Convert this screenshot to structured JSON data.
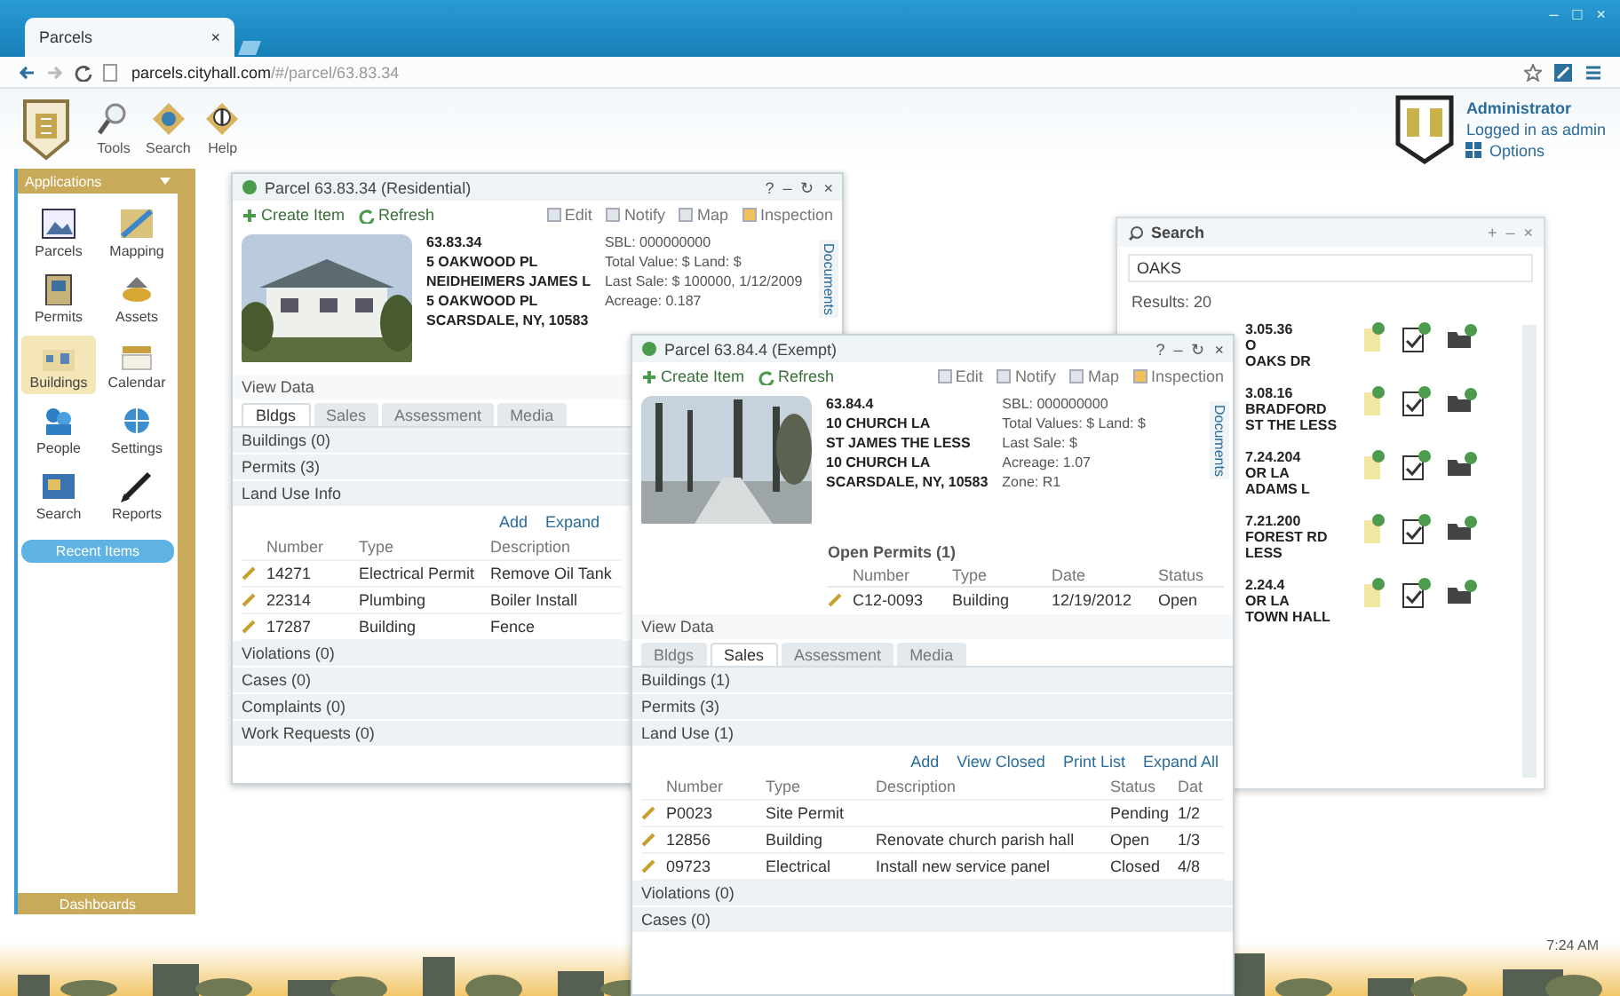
{
  "browser": {
    "tab_title": "Parcels",
    "tab_close": "×",
    "url": "parcels.cityhall.com",
    "url_tail": "/#/parcel/63.83.34",
    "window_controls": [
      "–",
      "□",
      "×"
    ]
  },
  "toolbar": {
    "items": [
      {
        "label": "Tools"
      },
      {
        "label": "Search"
      },
      {
        "label": "Help"
      }
    ]
  },
  "user": {
    "name": "Administrator",
    "status": "Logged in as admin",
    "menu": "Options"
  },
  "sidebar": {
    "title": "Applications",
    "items": [
      {
        "label": "Parcels",
        "selected": false
      },
      {
        "label": "Mapping",
        "selected": false
      },
      {
        "label": "Permits",
        "selected": false
      },
      {
        "label": "Assets",
        "selected": false
      },
      {
        "label": "Buildings",
        "selected": true
      },
      {
        "label": "Calendar",
        "selected": false
      },
      {
        "label": "People",
        "selected": false
      },
      {
        "label": "Settings",
        "selected": false
      },
      {
        "label": "Search",
        "selected": false
      },
      {
        "label": "Reports",
        "selected": false
      }
    ],
    "recent": "Recent Items",
    "footer": "Dashboards"
  },
  "windows": [
    {
      "title": "Parcel 63.83.34 (Residential)",
      "controls": [
        "?",
        "–",
        "↻",
        "×"
      ],
      "actions": [
        "Create Item",
        "Refresh"
      ],
      "right_actions": [
        "Edit",
        "Notify",
        "Map",
        "Inspection"
      ],
      "photo": {
        "kind": "picture"
      },
      "address": [
        "63.83.34",
        "5 OAKWOOD PL",
        "NEIDHEIMERS JAMES L",
        "5 OAKWOOD PL",
        "SCARSDALE, NY, 10583"
      ],
      "facts": [
        "SBL: 000000000",
        "Total Value: $ Land: $",
        "Last Sale: $ 100000, 1/12/2009",
        "Acreage: 0.187"
      ],
      "side_tab": "Documents",
      "section_title": "View Data",
      "tabs": [
        {
          "label": "Bldgs",
          "selected": true
        },
        {
          "label": "Sales",
          "selected": false
        },
        {
          "label": "Assessment",
          "selected": false
        },
        {
          "label": "Media",
          "selected": false
        }
      ],
      "sections": [
        "Buildings (0)",
        "Permits (3)",
        "Land Use Info"
      ],
      "links": [
        "Add",
        "Expand"
      ],
      "columns": [
        "Number",
        "Type",
        "Description"
      ],
      "rows": [
        [
          "14271",
          "Electrical Permit",
          "Remove Oil Tank"
        ],
        [
          "22314",
          "Plumbing",
          "Boiler Install"
        ],
        [
          "17287",
          "Building",
          "Fence"
        ]
      ],
      "more_sections": [
        "Violations (0)",
        "Cases (0)",
        "Complaints (0)",
        "Work Requests (0)"
      ]
    },
    {
      "title": "Parcel 63.84.4 (Exempt)",
      "controls": [
        "?",
        "–",
        "↻",
        "×"
      ],
      "actions": [
        "Create Item",
        "Refresh"
      ],
      "right_actions": [
        "Edit",
        "Notify",
        "Map",
        "Inspection"
      ],
      "photo": {
        "kind": "picture"
      },
      "address": [
        "63.84.4",
        "10 CHURCH LA",
        "ST JAMES THE LESS",
        "10 CHURCH LA",
        "SCARSDALE, NY, 10583"
      ],
      "facts": [
        "SBL: 000000000",
        "Total Values: $ Land: $",
        "Last Sale: $",
        "Acreage: 1.07",
        "Zone: R1"
      ],
      "side_tab": "Documents",
      "open_table": {
        "title": "Open Permits (1)",
        "columns": [
          "Number",
          "Type",
          "Date",
          "Status"
        ],
        "rows": [
          [
            "C12-0093",
            "Building",
            "12/19/2012",
            "Open"
          ]
        ]
      },
      "section_title": "View Data",
      "tabs": [
        {
          "label": "Bldgs",
          "selected": false
        },
        {
          "label": "Sales",
          "selected": true
        },
        {
          "label": "Assessment",
          "selected": false
        },
        {
          "label": "Media",
          "selected": false
        }
      ],
      "sections": [
        "Buildings (1)",
        "Permits (3)",
        "Land Use (1)"
      ],
      "links": [
        "Add",
        "View Closed",
        "Print List",
        "Expand All"
      ],
      "columns": [
        "Number",
        "Type",
        "Description",
        "Status",
        "Dat"
      ],
      "rows": [
        [
          "P0023",
          "Site Permit",
          "",
          "Pending",
          "1/2"
        ],
        [
          "12856",
          "Building",
          "Renovate church parish hall",
          "Open",
          "1/3"
        ],
        [
          "09723",
          "Electrical",
          "Install new service panel",
          "Closed",
          "4/8"
        ]
      ],
      "more_sections": [
        "Violations (0)",
        "Cases (0)"
      ]
    }
  ],
  "search": {
    "title": "Search",
    "controls": [
      "+",
      "–",
      "×"
    ],
    "query": "OAKS",
    "results_label": "Results: 20",
    "results": [
      {
        "lines": [
          "3.05.36",
          "O",
          "OAKS DR"
        ]
      },
      {
        "lines": [
          "3.08.16",
          "BRADFORD",
          "ST THE LESS"
        ]
      },
      {
        "lines": [
          "7.24.204",
          "OR LA",
          "ADAMS L"
        ]
      },
      {
        "lines": [
          "7.21.200",
          "FOREST RD",
          "LESS"
        ]
      },
      {
        "lines": [
          "2.24.4",
          "OR LA",
          "TOWN HALL"
        ]
      }
    ]
  },
  "clock": "7:24 AM"
}
